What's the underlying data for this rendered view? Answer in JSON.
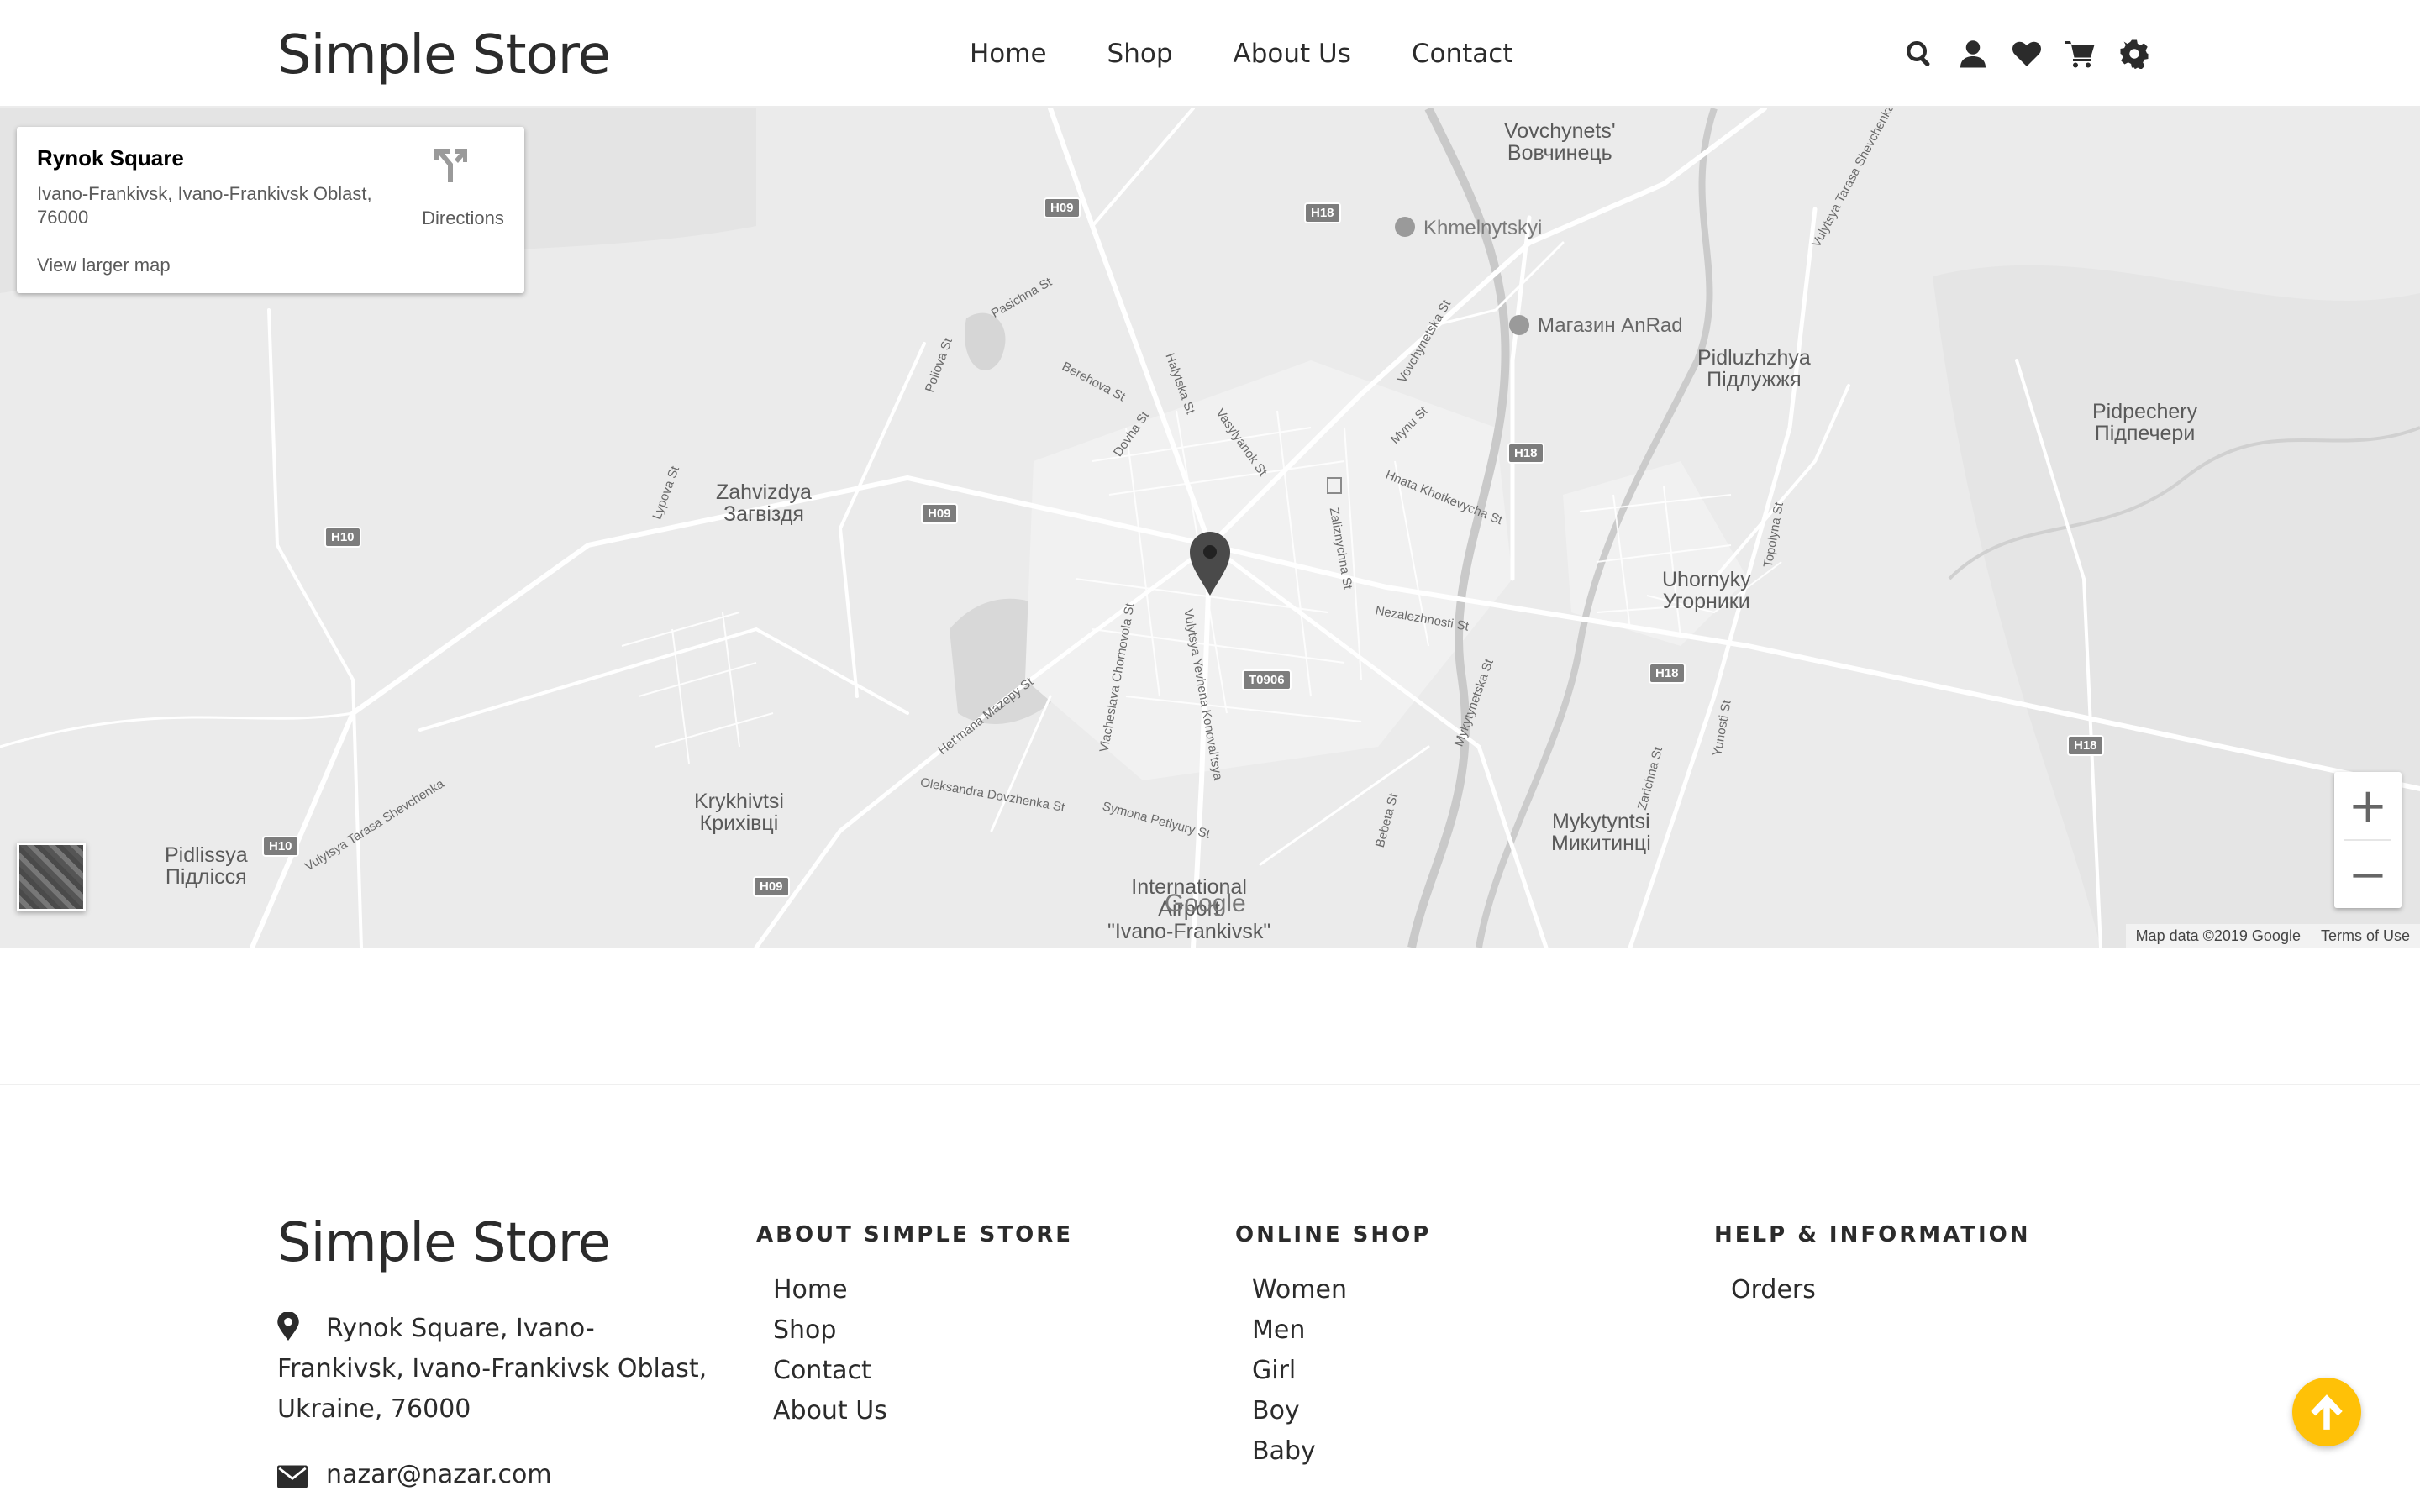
{
  "header": {
    "brand": "Simple Store",
    "nav": [
      "Home",
      "Shop",
      "About Us",
      "Contact"
    ],
    "icons": [
      "search-icon",
      "user-icon",
      "heart-icon",
      "cart-icon",
      "gear-icon"
    ]
  },
  "map": {
    "card": {
      "title": "Rynok Square",
      "address": "Ivano-Frankivsk, Ivano-Frankivsk Oblast, 76000",
      "larger_map": "View larger map",
      "directions": "Directions"
    },
    "labels": {
      "vovchynets": "Vovchynets'\nВовчинець",
      "khmelnytskyi": "Khmelnytskyi",
      "anrad": "Магазин AnRad",
      "pidluzhzhya": "Pidluzhzhya\nПідлужжя",
      "pidpechery": "Pidpechery\nПідпечери",
      "zahvizdya": "Zahvizdya\nЗагвіздя",
      "uhornyky": "Uhornyky\nУгорники",
      "krykhivtsi": "Krykhivtsi\nКрихівці",
      "mykytyntsi": "Mykytyntsi\nМикитинці",
      "pidlissya": "Pidlissya\nПідлісся",
      "airport": "International\nAirport\n\"Ivano-Frankivsk\""
    },
    "streets": {
      "pasichna": "Pasichna St",
      "bereshova": "Berehova St",
      "halytska": "Halytska St",
      "dovha": "Dovha St",
      "vasylyanok": "Vasylyanok St",
      "vovchynetska": "Vovchynetska St",
      "mynu": "Mynu St",
      "hnata": "Hnata Khotkevycha St",
      "zaliznychna": "Zaliznychna St",
      "nezalezhnosti": "Nezalezhnosti St",
      "lypova": "Lypova St",
      "poliova": "Poliova St",
      "chornovola": "Viacheslava Chornovola St",
      "mazepy": "Het'mana Mazepy St",
      "dovzhenka": "Oleksandra Dovzhenka St",
      "petlyury": "Symona Petlyury St",
      "konovaltsya": "Vulytsya Yevhena Konoval'tsya",
      "mykytynetska": "Mykytynetska St",
      "bebeta": "Bebeta St",
      "shevchenka": "Vulytsya Tarasa Shevchenka",
      "shevchenka2": "Vulytsya Tarasa Shevchenka",
      "topolyna": "Topolyna St",
      "zarichna": "Zarichna St",
      "yunosti": "Yunosti St"
    },
    "shields": {
      "h09a": "H09",
      "h18a": "H18",
      "h18b": "H18",
      "h09b": "H09",
      "h10a": "H10",
      "t0906": "T0906",
      "h18c": "H18",
      "h18d": "H18",
      "h10b": "H10",
      "h09c": "H09"
    },
    "zoom_in": "+",
    "zoom_out": "−",
    "google": "Google",
    "attribution": "Map data ©2019 Google",
    "terms": "Terms of Use"
  },
  "footer": {
    "brand": "Simple Store",
    "address": "Rynok Square, Ivano-Frankivsk, Ivano-Frankivsk Oblast, Ukraine, 76000",
    "email": "nazar@nazar.com",
    "about": {
      "title": "ABOUT SIMPLE STORE",
      "items": [
        "Home",
        "Shop",
        "Contact",
        "About Us"
      ]
    },
    "online_shop": {
      "title": "ONLINE SHOP",
      "items": [
        "Women",
        "Men",
        "Girl",
        "Boy",
        "Baby"
      ]
    },
    "help": {
      "title": "HELP & INFORMATION",
      "items": [
        "Orders"
      ]
    }
  },
  "colors": {
    "accent": "#ffc107",
    "text": "#2b2b2b",
    "map_bg": "#ebebeb"
  }
}
